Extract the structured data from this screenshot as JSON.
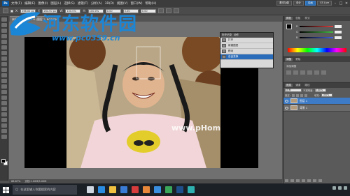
{
  "app": {
    "logo_text": "Ps",
    "menu": [
      "文件(F)",
      "编辑(E)",
      "图像(I)",
      "图层(L)",
      "选择(S)",
      "滤镜(T)",
      "分析(A)",
      "3D(D)",
      "视图(V)",
      "窗口(W)",
      "帮助(H)"
    ],
    "workspace_buttons": [
      "基本功能",
      "设计",
      "绘画"
    ],
    "cs_live": "CS Live"
  },
  "options_bar": {
    "x_label": "X:",
    "x_value": "266.00 px",
    "y_label": "Y:",
    "y_value": "264.50 px",
    "w_label": "W:",
    "w_value": "100.0%",
    "h_label": "H:",
    "h_value": "100.0%",
    "angle_value": "0.00",
    "h_skew": "0.00",
    "v_skew": "0.00"
  },
  "document": {
    "tab_title": "未标题-1 @ 66.7% (图层 1, RGB/8)",
    "zoom": "66.67%",
    "doc_info": "文档:1.00M/5.00M"
  },
  "history_panel": {
    "tabs": [
      "历史记录",
      "动作"
    ],
    "items": [
      "打开",
      "新建图层",
      "移动",
      "自由变换"
    ],
    "selected_index": 3
  },
  "color_panel": {
    "tabs": [
      "颜色",
      "色板",
      "样式"
    ],
    "sliders": [
      {
        "letter": "R",
        "color": "#e04040"
      },
      {
        "letter": "G",
        "color": "#40c040"
      },
      {
        "letter": "B",
        "color": "#4060e0"
      }
    ]
  },
  "adjustments_panel": {
    "tabs": [
      "调整",
      "蒙版"
    ],
    "hint": "添加调整"
  },
  "layers_panel": {
    "tabs": [
      "图层",
      "通道",
      "路径"
    ],
    "blend_mode": "正常",
    "opacity_label": "不透明度:",
    "opacity_value": "100%",
    "lock_label": "锁定:",
    "fill_label": "填充:",
    "fill_value": "100%",
    "layers": [
      {
        "name": "图层 1",
        "selected": true
      },
      {
        "name": "背景 1",
        "selected": false
      }
    ]
  },
  "watermark": {
    "title": "河东软件园",
    "url": "www.pc0359.cn",
    "photo_mark": "www.pHome.NET"
  },
  "taskbar": {
    "search_placeholder": "在这里输入你要搜索的内容",
    "app_icons": [
      {
        "name": "task-view",
        "color": "#cfd6df"
      },
      {
        "name": "edge",
        "color": "#2b8be0"
      },
      {
        "name": "explorer",
        "color": "#f0c040"
      },
      {
        "name": "store",
        "color": "#3a7bd5"
      },
      {
        "name": "app-red",
        "color": "#d83b3b"
      },
      {
        "name": "app-orange",
        "color": "#e8873a"
      },
      {
        "name": "app-blue",
        "color": "#3a8ee0"
      },
      {
        "name": "app-green",
        "color": "#3aa65a"
      },
      {
        "name": "photoshop",
        "color": "#1f4f8a"
      },
      {
        "name": "app-teal",
        "color": "#2eb0b0"
      }
    ]
  }
}
